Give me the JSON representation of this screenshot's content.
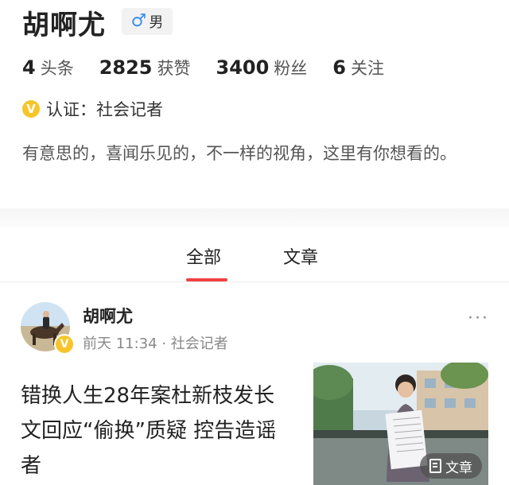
{
  "profile": {
    "name": "胡啊尤",
    "gender_icon": "male-symbol-icon",
    "gender_symbol": "♂",
    "gender_label": "男",
    "stats": [
      {
        "num": "4",
        "label": "头条"
      },
      {
        "num": "2825",
        "label": "获赞"
      },
      {
        "num": "3400",
        "label": "粉丝"
      },
      {
        "num": "6",
        "label": "关注"
      }
    ],
    "verify_badge": "V",
    "verify_label": "认证：社会记者",
    "bio": "有意思的，喜闻乐见的，不一样的视角，这里有你想看的。"
  },
  "tabs": [
    {
      "label": "全部",
      "active": true
    },
    {
      "label": "文章",
      "active": false
    }
  ],
  "post": {
    "author": "胡啊尤",
    "badge": "V",
    "meta": "前天 11:34 · 社会记者",
    "more": "···",
    "headline": "错换人生28年案杜新枝发长文回应“偷换”质疑 控告造谣者",
    "tag_label": "文章",
    "tag_icon": "document-icon"
  },
  "colors": {
    "accent": "#f04142",
    "verify_badge": "#f7c52a",
    "male_icon": "#3d8ef0"
  }
}
